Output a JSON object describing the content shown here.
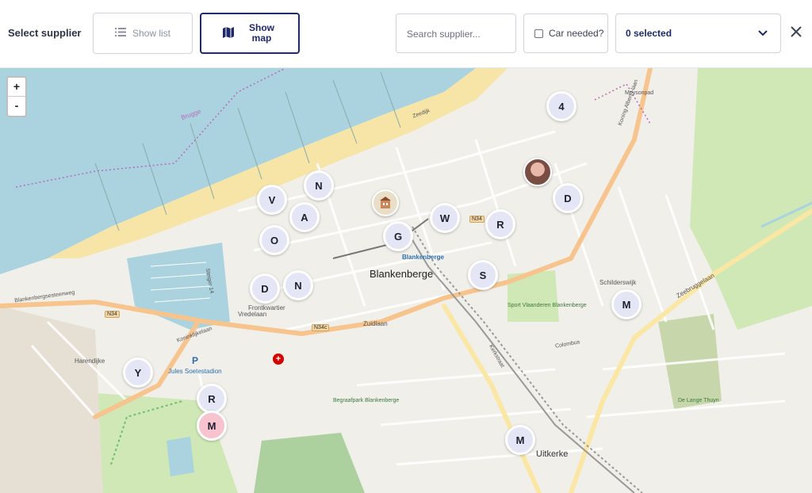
{
  "header": {
    "title": "Select supplier",
    "show_list_label": "Show list",
    "show_map_label": "Show map",
    "search_placeholder": "Search supplier...",
    "car_needed_label": "Car needed?",
    "selected_label": "0 selected"
  },
  "map": {
    "zoom_in": "+",
    "zoom_out": "-",
    "labels": {
      "town": "Blankenberge",
      "town2": "Uitkerke",
      "station": "Blankenberge",
      "jules": "Jules Soetestadion",
      "sport": "Sport Vlaanderen Blankenberge",
      "begraaf": "Begraafpark Blankenberge",
      "frontkwartier": "Frontkwartier",
      "schildersvijk": "Schilderswijk",
      "delange": "De Lange Thuyn",
      "brugge": "Brugge",
      "zuidlaan": "Zuidlaan",
      "vredelaan": "Vredelaan",
      "zeebruggelaan": "Zeebruggelaan",
      "kerkstraat": "Kerkstraat",
      "n34": "N34",
      "n34c": "N34c",
      "koninklijkelaan": "Koninklijkelaan",
      "blankenbergsesteenweg": "Blankenbergsesteenweg",
      "harendijke": "Harendijke",
      "steiger": "Steiger 14",
      "zeedijk": "Zeedijk",
      "colombus": "Colombus",
      "albert": "Koning Albert I-laan",
      "moysonpad": "Moysonpad"
    },
    "markers": [
      {
        "label": "4",
        "style": "default"
      },
      {
        "label": "N",
        "style": "default"
      },
      {
        "label": "V",
        "style": "default"
      },
      {
        "label": "A",
        "style": "default"
      },
      {
        "label": "O",
        "style": "default"
      },
      {
        "label": "D",
        "style": "default"
      },
      {
        "label": "N",
        "style": "default"
      },
      {
        "label": "G",
        "style": "default"
      },
      {
        "label": "W",
        "style": "default"
      },
      {
        "label": "R",
        "style": "default"
      },
      {
        "label": "S",
        "style": "default"
      },
      {
        "label": "D",
        "style": "default"
      },
      {
        "label": "M",
        "style": "default"
      },
      {
        "label": "Y",
        "style": "default"
      },
      {
        "label": "R",
        "style": "default"
      },
      {
        "label": "M",
        "style": "pink"
      },
      {
        "label": "M",
        "style": "default"
      }
    ]
  }
}
